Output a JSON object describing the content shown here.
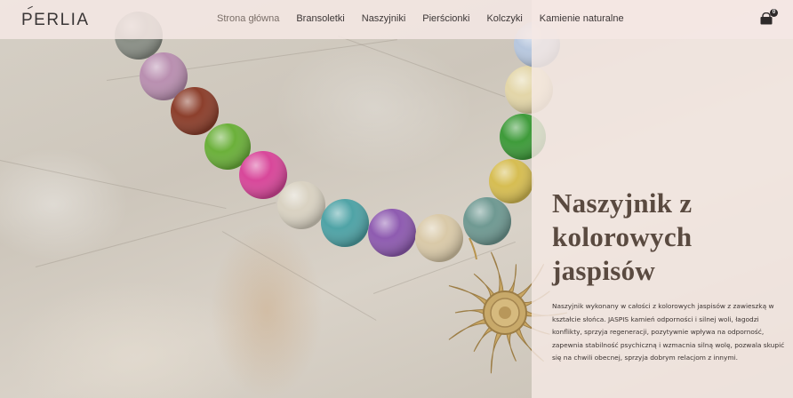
{
  "brand": {
    "logo_text": "PERLIA"
  },
  "nav": {
    "items": [
      {
        "label": "Strona główna",
        "active": true
      },
      {
        "label": "Bransoletki",
        "active": false
      },
      {
        "label": "Naszyjniki",
        "active": false
      },
      {
        "label": "Pierścionki",
        "active": false
      },
      {
        "label": "Kolczyki",
        "active": false
      },
      {
        "label": "Kamienie naturalne",
        "active": false
      }
    ]
  },
  "cart": {
    "icon": "shopping-bag-icon",
    "count": "0"
  },
  "hero": {
    "title": "Naszyjnik z kolorowych jaspisów",
    "description": "Naszyjnik wykonany w całości z kolorowych jaspisów z zawieszką w kształcie słońca. JASPIS kamień odporności i silnej woli, łagodzi konflikty, sprzyja regeneracji, pozytywnie wpływa na odporność, zapewnia stabilność psychiczną i wzmacnia silną wolę, pozwala skupić się na chwili obecnej, sprzyja dobrym relacjom z innymi.",
    "image": "necklace-with-colorful-jasper-beads-and-sun-pendant"
  },
  "colors": {
    "header_bg": "#f4e8e4",
    "panel_bg": "#f5e9e4",
    "title": "#5a4a40",
    "text": "#3b3331"
  }
}
